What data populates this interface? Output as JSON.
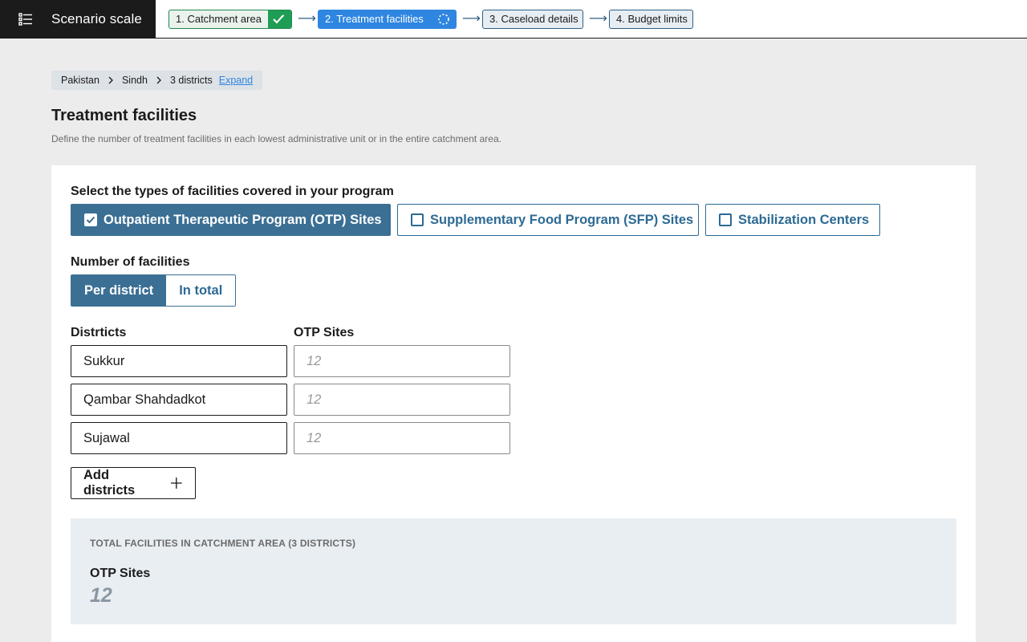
{
  "app": {
    "title": "Scenario scale",
    "menu_icon": "list-menu-icon"
  },
  "steps": [
    {
      "label": "1. Catchment area",
      "status": "complete",
      "status_icon": "checkmark-icon"
    },
    {
      "label": "2. Treatment facilities",
      "status": "in-progress",
      "status_icon": "progress-spinner-icon"
    },
    {
      "label": "3. Caseload details",
      "status": "pending"
    },
    {
      "label": "4. Budget limits",
      "status": "pending"
    }
  ],
  "breadcrumb": {
    "items": [
      "Pakistan",
      "Sindh",
      "3 districts"
    ],
    "expand_label": "Expand"
  },
  "page": {
    "title": "Treatment facilities",
    "description": "Define the number of treatment facilities in each lowest administrative unit or in the entire catchment area."
  },
  "facility_types": {
    "label": "Select the types of facilities covered in your program",
    "options": [
      {
        "label": "Outpatient Therapeutic Program (OTP) Sites",
        "checked": true
      },
      {
        "label": "Supplementary Food Program (SFP) Sites",
        "checked": false
      },
      {
        "label": "Stabilization Centers",
        "checked": false
      }
    ]
  },
  "number_of_facilities": {
    "label": "Number of facilities",
    "options": [
      "Per district",
      "In total"
    ],
    "selected": "Per district"
  },
  "table": {
    "district_header": "Distrticts",
    "otp_header": "OTP Sites",
    "rows": [
      {
        "district": "Sukkur",
        "otp_placeholder": "12"
      },
      {
        "district": "Qambar Shahdadkot",
        "otp_placeholder": "12"
      },
      {
        "district": "Sujawal",
        "otp_placeholder": "12"
      }
    ]
  },
  "add_districts_label": "Add districts",
  "summary": {
    "title": "TOTAL FACILITIES IN CATCHMENT AREA (3 DISTRICTS)",
    "label": "OTP Sites",
    "value": "12"
  },
  "colors": {
    "brand_bar": "#1b1b1b",
    "active_step": "#2f86e0",
    "complete_step": "#1f9d55",
    "primary": "#3b6f94",
    "summary_bg": "#e9eef3"
  }
}
